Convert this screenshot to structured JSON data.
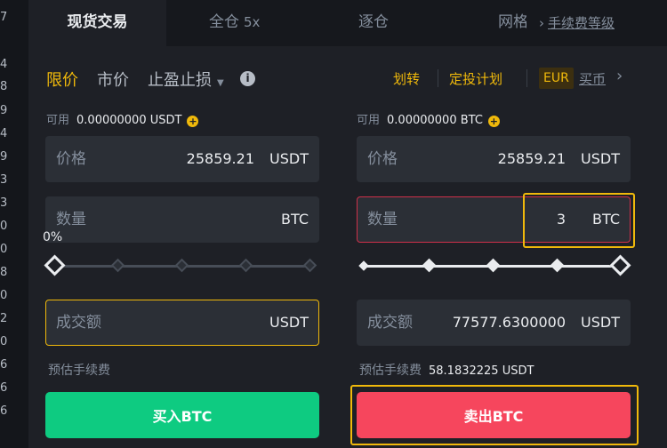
{
  "order_book_edge": [
    "7",
    "4",
    "8",
    "9",
    "4",
    "9",
    "3",
    "3",
    "0",
    "0",
    "8",
    "0",
    "2",
    "0",
    "6",
    "6",
    "6"
  ],
  "tabs": [
    {
      "label": "现货交易",
      "active": true
    },
    {
      "label": "全仓",
      "leverage": "5x"
    },
    {
      "label": "逐仓"
    },
    {
      "label": "网格"
    }
  ],
  "fee_level_link": "手续费等级",
  "order_types": {
    "limit": "限价",
    "market": "市价",
    "stop_limit": "止盈止损"
  },
  "info_icon_glyph": "i",
  "top_links": {
    "transfer": "划转",
    "recurring": "定投计划",
    "currency_badge": "EUR",
    "buy_crypto": "买币"
  },
  "buy_form": {
    "available_label": "可用",
    "available_value": "0.00000000 USDT",
    "price_label": "价格",
    "price_value": "25859.21",
    "price_unit": "USDT",
    "amount_label": "数量",
    "amount_value": "",
    "amount_unit": "BTC",
    "slider_percent_label": "0%",
    "slider_percent": 0,
    "total_label": "成交额",
    "total_value": "",
    "total_unit": "USDT",
    "fee_label": "预估手续费",
    "fee_value": "",
    "button_label": "买入BTC"
  },
  "sell_form": {
    "available_label": "可用",
    "available_value": "0.00000000 BTC",
    "price_label": "价格",
    "price_value": "25859.21",
    "price_unit": "USDT",
    "amount_label": "数量",
    "amount_value": "3",
    "amount_unit": "BTC",
    "slider_percent": 100,
    "total_label": "成交额",
    "total_value": "77577.6300000",
    "total_unit": "USDT",
    "fee_label": "预估手续费",
    "fee_value": "58.1832225 USDT",
    "button_label": "卖出BTC"
  },
  "colors": {
    "accent": "#f0b90b",
    "buy": "#0ecb81",
    "sell": "#f6465d",
    "background": "#1e2026",
    "input": "#2b2f36"
  }
}
